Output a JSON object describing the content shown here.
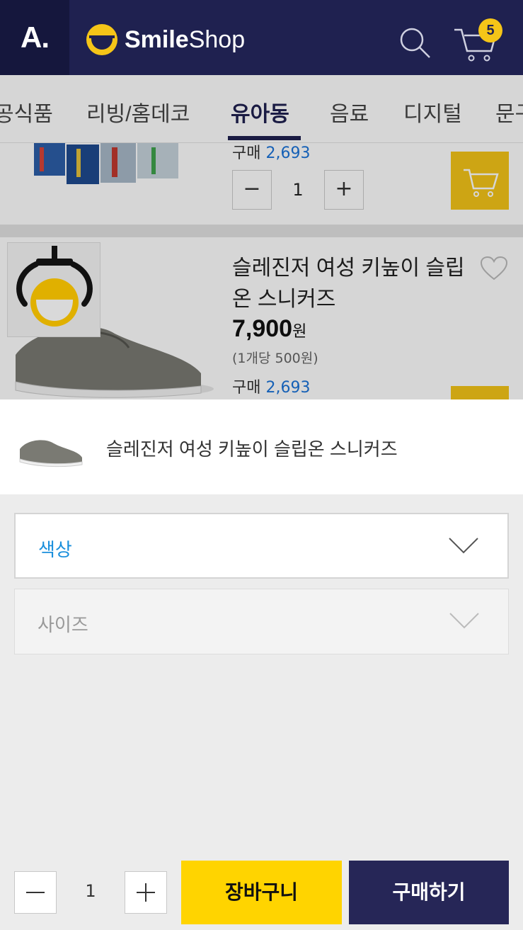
{
  "header": {
    "brand_letter": "A.",
    "logo_bold": "Smile",
    "logo_light": "Shop",
    "cart_count": "5",
    "icons": [
      "search-icon",
      "cart-icon"
    ],
    "colors": {
      "header_bg": "#1f2150",
      "accent": "#f5c518"
    }
  },
  "tabs": [
    {
      "label": "공식품"
    },
    {
      "label": "리빙/홈데코"
    },
    {
      "label": "유아동",
      "active": true
    },
    {
      "label": "음료"
    },
    {
      "label": "디지털"
    },
    {
      "label": "문구"
    }
  ],
  "list": {
    "item1": {
      "buy_prefix": "구매",
      "buy_count": "2,693",
      "qty": "1"
    },
    "item2": {
      "title": "슬레진저 여성 키높이 슬립온 스니커즈",
      "price": "7,900",
      "price_unit": "원",
      "unit_price": "(1개당 500원)",
      "buy_prefix": "구매",
      "buy_count": "2,693"
    }
  },
  "sheet": {
    "product_title": "슬레진저 여성 키높이 슬립온 스니커즈",
    "option_color": "색상",
    "option_size": "사이즈",
    "qty": "1",
    "add_to_cart": "장바구니",
    "buy_now": "구매하기"
  }
}
